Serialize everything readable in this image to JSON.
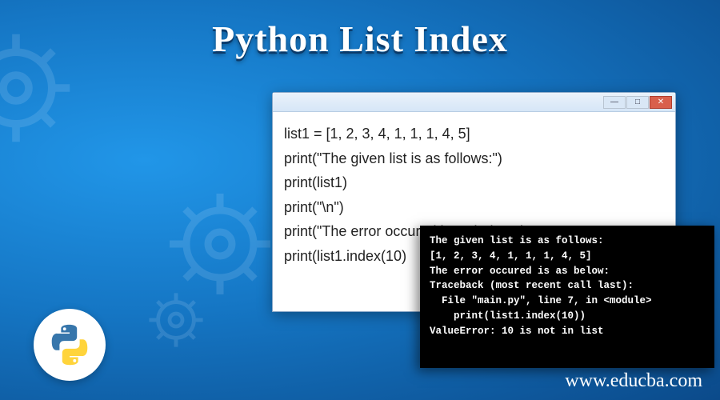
{
  "title": "Python List Index",
  "window": {
    "close": "✕",
    "max": "□",
    "min": "—"
  },
  "code": {
    "lines": [
      "list1 = [1, 2, 3, 4, 1, 1, 1, 4, 5]",
      "print(\"The given list is as follows:\")",
      "print(list1)",
      "print(\"\\n\")",
      "print(\"The error occured is as below:\")",
      "print(list1.index(10)"
    ]
  },
  "terminal": {
    "lines": [
      "The given list is as follows:",
      "[1, 2, 3, 4, 1, 1, 1, 4, 5]",
      "",
      "",
      "The error occured is as below:",
      "Traceback (most recent call last):",
      "  File \"main.py\", line 7, in <module>",
      "    print(list1.index(10))",
      "ValueError: 10 is not in list"
    ]
  },
  "url": "www.educba.com",
  "icons": {
    "gear": "gear-icon",
    "python": "python-logo-icon"
  }
}
